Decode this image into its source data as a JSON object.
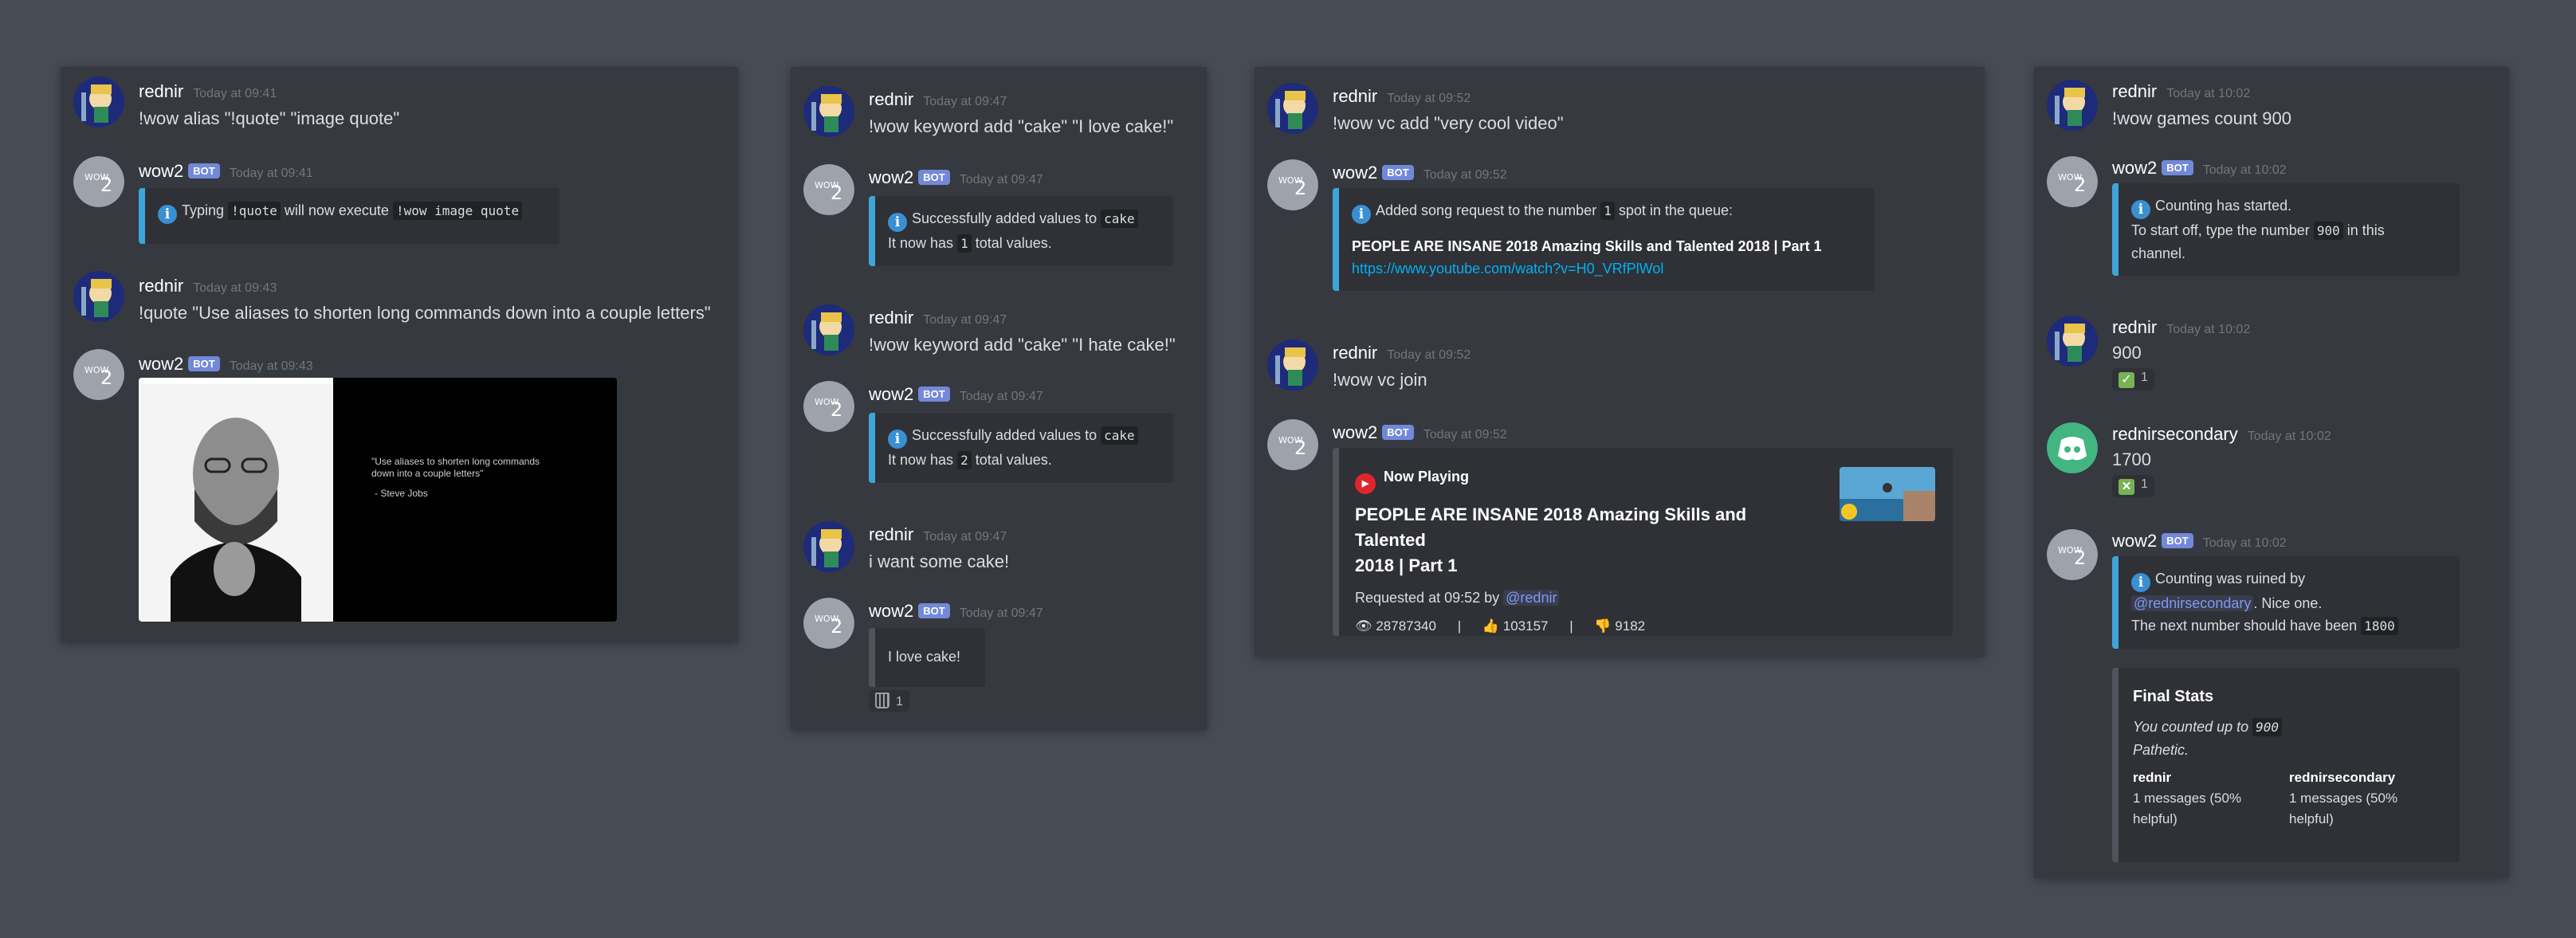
{
  "colors": {
    "background": "#474b54",
    "panel": "#36393f",
    "embed": "#2f3136",
    "accent_blue": "#3da5d9",
    "bot_badge": "#7289da"
  },
  "users": {
    "rednir": "rednir",
    "wow2": "wow2",
    "rednirsecondary": "rednirsecondary",
    "bot_tag": "BOT"
  },
  "panel1": {
    "m1": {
      "time": "Today at 09:41",
      "text": "!wow alias \"!quote\" \"image quote\""
    },
    "m2": {
      "time": "Today at 09:41",
      "pre": "Typing",
      "code1": "!quote",
      "mid": "will now execute",
      "code2": "!wow image quote"
    },
    "m3": {
      "time": "Today at 09:43",
      "text": "!quote \"Use aliases to shorten long commands down into a couple letters\""
    },
    "m4": {
      "time": "Today at 09:43",
      "quote_line1": "\"Use aliases to shorten long commands",
      "quote_line2": "down into a couple letters\"",
      "quote_author": "- Steve Jobs"
    }
  },
  "panel2": {
    "m1": {
      "time": "Today at 09:47",
      "text": "!wow keyword add \"cake\" \"I love cake!\""
    },
    "m2": {
      "time": "Today at 09:47",
      "pre": "Successfully added values to",
      "code": "cake",
      "l2a": "It now has",
      "count": "1",
      "l2b": "total values."
    },
    "m3": {
      "time": "Today at 09:47",
      "text": "!wow keyword add \"cake\" \"I hate cake!\""
    },
    "m4": {
      "time": "Today at 09:47",
      "pre": "Successfully added values to",
      "code": "cake",
      "l2a": "It now has",
      "count": "2",
      "l2b": "total values."
    },
    "m5": {
      "time": "Today at 09:47",
      "text": "i want some cake!"
    },
    "m6": {
      "time": "Today at 09:47",
      "embed": "I love cake!",
      "reaction_count": "1",
      "reaction_icon": "wastebasket-icon"
    }
  },
  "panel3": {
    "m1": {
      "time": "Today at 09:52",
      "text": "!wow vc add \"very cool video\""
    },
    "m2": {
      "time": "Today at 09:52",
      "pre": "Added song request to the number",
      "code": "1",
      "post": "spot in the queue:",
      "title": "PEOPLE ARE INSANE 2018   Amazing Skills and Talented 2018 | Part 1",
      "url": "https://www.youtube.com/watch?v=H0_VRfPlWol"
    },
    "m3": {
      "time": "Today at 09:52",
      "text": "!wow vc join"
    },
    "m4": {
      "time": "Today at 09:52",
      "header": "Now Playing",
      "title_l1": "PEOPLE ARE INSANE 2018   Amazing Skills and Talented",
      "title_l2": "2018 | Part 1",
      "requested": "Requested at 09:52 by",
      "mention": "@rednir",
      "views": "28787340",
      "likes": "103157",
      "dislikes": "9182",
      "sep": "|"
    }
  },
  "panel4": {
    "m1": {
      "time": "Today at 10:02",
      "text": "!wow games count 900"
    },
    "m2": {
      "time": "Today at 10:02",
      "l1": "Counting has started.",
      "l2a": "To start off, type the number",
      "code": "900",
      "l2b": "in this",
      "l3": "channel."
    },
    "m3": {
      "time": "Today at 10:02",
      "text": "900",
      "reaction_count": "1"
    },
    "m4": {
      "time": "Today at 10:02",
      "text": "1700",
      "reaction_count": "1"
    },
    "m5": {
      "time": "Today at 10:02",
      "l1a": "Counting was ruined by",
      "mention": "@rednirsecondary",
      "l1b": ". Nice one.",
      "l2a": "The next number should have been",
      "code": "1800",
      "stats_title": "Final Stats",
      "stats_l1a": "You counted up to",
      "stats_code": "900",
      "stats_l2": "Pathetic.",
      "col1_name": "rednir",
      "col1_l1": "1 messages (50%",
      "col1_l2": "helpful)",
      "col2_name": "rednirsecondary",
      "col2_l1": "1 messages (50%",
      "col2_l2": "helpful)"
    }
  }
}
